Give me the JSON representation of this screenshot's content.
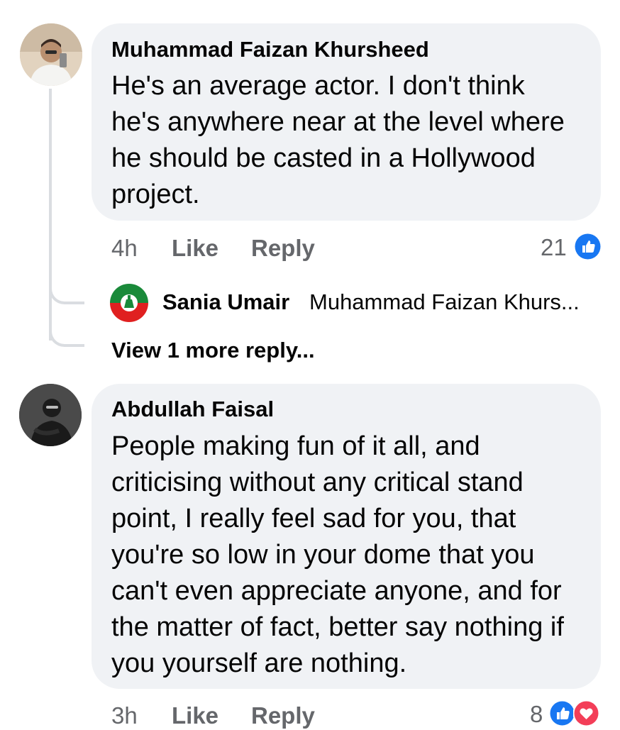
{
  "comments": [
    {
      "author": "Muhammad Faizan Khursheed",
      "text": "He's an average actor. I don't think he's anywhere near at the level where he should be casted in a Hollywood project.",
      "time": "4h",
      "like_label": "Like",
      "reply_label": "Reply",
      "reaction_count": "21",
      "reactions": [
        "like-reaction-icon"
      ],
      "replies_preview": {
        "author": "Sania Umair",
        "text": "Muhammad Faizan Khurs..."
      },
      "view_more": "View 1 more reply..."
    },
    {
      "author": "Abdullah Faisal",
      "text": "People making fun of it all, and criticising without any critical stand point, I really feel sad for you, that you're so low in your dome that you can't even appreciate anyone, and for the matter of fact, better say nothing if you yourself are nothing.",
      "time": "3h",
      "like_label": "Like",
      "reply_label": "Reply",
      "reaction_count": "8",
      "reactions": [
        "like-reaction-icon",
        "love-reaction-icon"
      ]
    }
  ],
  "colors": {
    "bubble": "#f0f2f5",
    "meta": "#65676b",
    "like_blue": "#1877f2",
    "love_red": "#f33e58"
  }
}
